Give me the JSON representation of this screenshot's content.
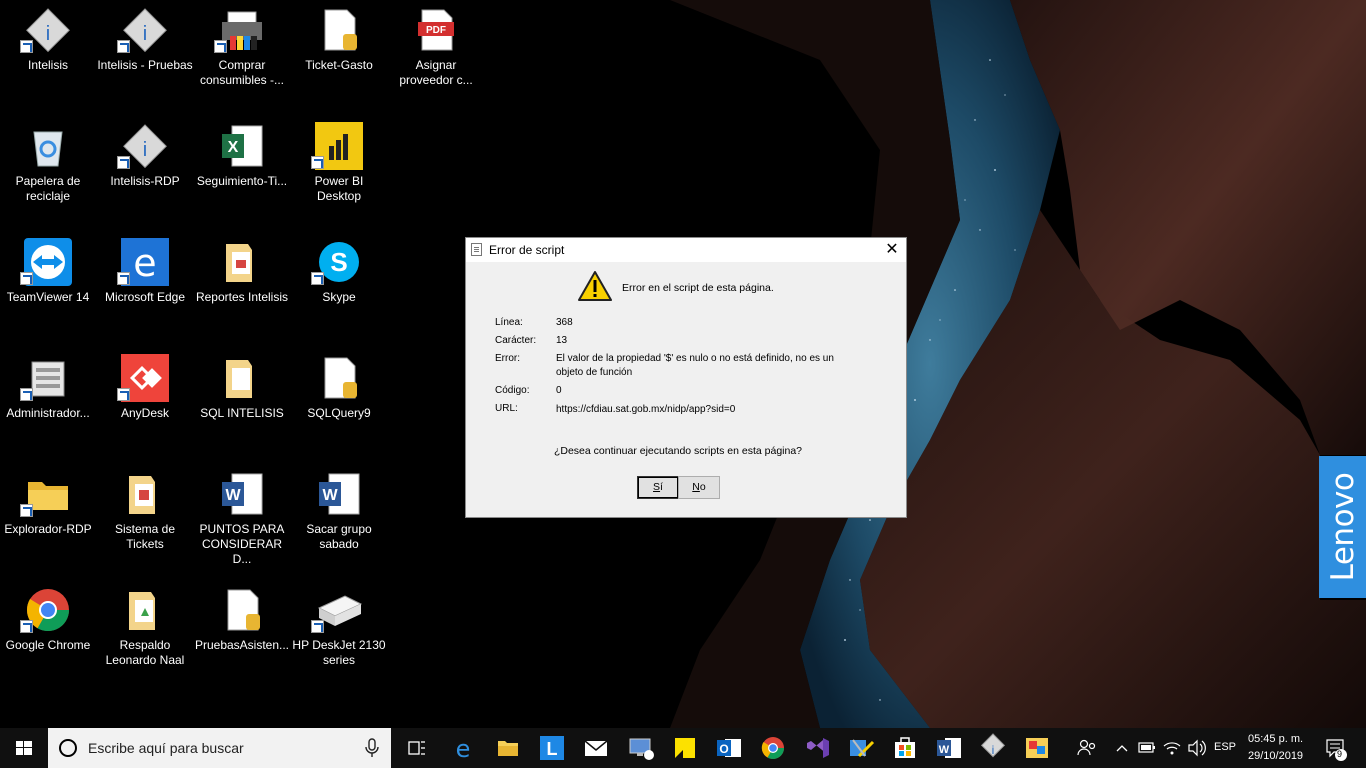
{
  "desktop": {
    "icons": [
      {
        "label": "Intelisis",
        "icon": "intelisis-icon"
      },
      {
        "label": "Intelisis - Pruebas",
        "icon": "intelisis-icon"
      },
      {
        "label": "Comprar consumibles -...",
        "icon": "printer-icon"
      },
      {
        "label": "Ticket-Gasto",
        "icon": "document-icon"
      },
      {
        "label": "Asignar proveedor c...",
        "icon": "pdf-icon"
      },
      {
        "label": "Papelera de reciclaje",
        "icon": "recycle-bin-icon"
      },
      {
        "label": "Intelisis-RDP",
        "icon": "intelisis-icon"
      },
      {
        "label": "Seguimiento-Ti...",
        "icon": "excel-icon"
      },
      {
        "label": "Power BI Desktop",
        "icon": "powerbi-icon"
      },
      {
        "label": "TeamViewer 14",
        "icon": "teamviewer-icon"
      },
      {
        "label": "Microsoft Edge",
        "icon": "edge-icon"
      },
      {
        "label": "Reportes Intelisis",
        "icon": "folder-icon"
      },
      {
        "label": "Skype",
        "icon": "skype-icon"
      },
      {
        "label": "Administrador...",
        "icon": "admin-icon"
      },
      {
        "label": "AnyDesk",
        "icon": "anydesk-icon"
      },
      {
        "label": "SQL INTELISIS",
        "icon": "folder-icon"
      },
      {
        "label": "SQLQuery9",
        "icon": "document-icon"
      },
      {
        "label": "Explorador-RDP",
        "icon": "folder-icon"
      },
      {
        "label": "Sistema de Tickets",
        "icon": "folder-icon"
      },
      {
        "label": "PUNTOS PARA CONSIDERAR D...",
        "icon": "word-icon"
      },
      {
        "label": "Sacar grupo sabado",
        "icon": "word-icon"
      },
      {
        "label": "Google Chrome",
        "icon": "chrome-icon"
      },
      {
        "label": "Respaldo Leonardo Naal",
        "icon": "folder-icon"
      },
      {
        "label": "PruebasAsisten...",
        "icon": "document-icon"
      },
      {
        "label": "HP DeskJet 2130 series",
        "icon": "printer-icon"
      }
    ]
  },
  "brand": {
    "text": "Lenovo",
    "color": "#2f8fdf"
  },
  "dialog": {
    "title": "Error de script",
    "message": "Error en el script de esta página.",
    "rows": [
      {
        "label": "Línea:",
        "value": "368"
      },
      {
        "label": "Carácter:",
        "value": "13"
      },
      {
        "label": "Error:",
        "value": "El valor de la propiedad '$' es nulo o no está definido, no es un objeto de función"
      },
      {
        "label": "Código:",
        "value": "0"
      },
      {
        "label": "URL:",
        "value": "https://cfdiau.sat.gob.mx/nidp/app?sid=0"
      }
    ],
    "question": "¿Desea continuar ejecutando scripts en esta página?",
    "yes_label": "Sí",
    "no_label": "No"
  },
  "taskbar": {
    "search_placeholder": "Escribe aquí para buscar",
    "language": "ESP",
    "time": "05:45 p. m.",
    "date": "29/10/2019",
    "notification_count": "9"
  }
}
